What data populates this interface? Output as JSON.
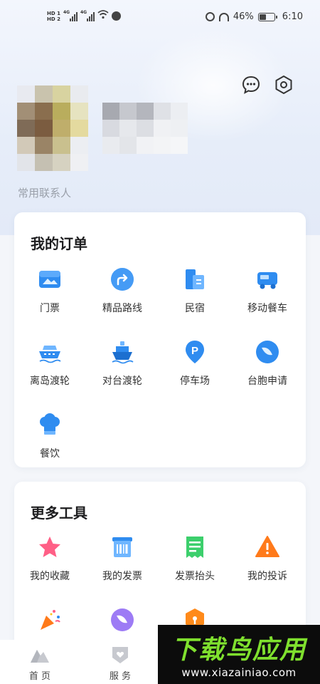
{
  "status_bar": {
    "battery": "46%",
    "time": "6:10",
    "network_left": [
      "HD 1",
      "HD 2"
    ],
    "signal_labels": [
      "4G",
      "4G"
    ]
  },
  "header": {
    "contacts_label": "常用联系人",
    "chat_icon": "chat-bubble-icon",
    "settings_icon": "settings-hexagon-icon"
  },
  "orders": {
    "title": "我的订单",
    "items": [
      {
        "label": "门票",
        "icon": "ticket-image-icon"
      },
      {
        "label": "精品路线",
        "icon": "route-arrow-icon"
      },
      {
        "label": "民宿",
        "icon": "homestay-building-icon"
      },
      {
        "label": "移动餐车",
        "icon": "food-truck-icon"
      },
      {
        "label": "离岛渡轮",
        "icon": "ferry-icon"
      },
      {
        "label": "对台渡轮",
        "icon": "ship-icon"
      },
      {
        "label": "停车场",
        "icon": "parking-pin-icon"
      },
      {
        "label": "台胞申请",
        "icon": "application-leaf-icon"
      },
      {
        "label": "餐饮",
        "icon": "chef-hat-icon"
      }
    ]
  },
  "tools": {
    "title": "更多工具",
    "items": [
      {
        "label": "我的收藏",
        "icon": "star-icon"
      },
      {
        "label": "我的发票",
        "icon": "invoice-barcode-icon"
      },
      {
        "label": "发票抬头",
        "icon": "invoice-title-icon"
      },
      {
        "label": "我的投诉",
        "icon": "warning-icon"
      }
    ]
  },
  "tabbar": {
    "tabs": [
      {
        "label": "首 页",
        "icon": "home-mountain-icon"
      },
      {
        "label": "服 务",
        "icon": "service-shield-icon"
      }
    ]
  },
  "watermark": {
    "title": "下载鸟应用",
    "url": "www.xiazainiao.com"
  },
  "colors": {
    "primary_blue": "#2f8cf0",
    "accent_orange": "#ff7a1a",
    "accent_green": "#3ccf6c",
    "accent_pink": "#ff5f86",
    "watermark_green": "#7fe02e"
  }
}
